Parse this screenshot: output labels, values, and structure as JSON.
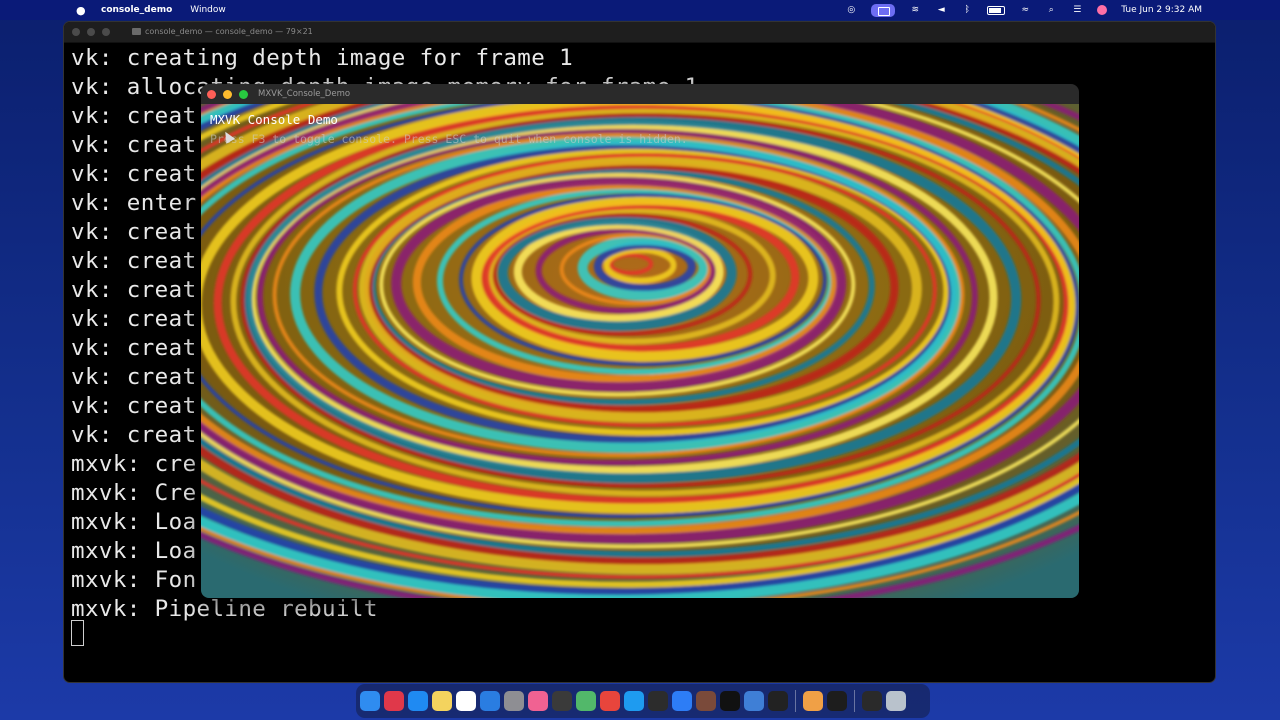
{
  "menubar": {
    "apple": "",
    "app_name": "console_demo",
    "menu_window": "Window",
    "datetime": "Tue Jun 2  9:32 AM",
    "icons": [
      "screen-record-icon",
      "display-icon",
      "stage-manager-icon",
      "volume-icon",
      "bluetooth-icon",
      "battery-icon",
      "wifi-icon",
      "spotlight-icon",
      "control-center-icon",
      "siri-icon"
    ]
  },
  "terminal": {
    "title": "console_demo — console_demo — 79×21",
    "lines": [
      "vk: creating depth image for frame 1",
      "vk: allocating depth image memory for frame 1",
      "vk: creat",
      "vk: creat",
      "vk: creat",
      "vk: enter",
      "vk: creat",
      "vk: creat",
      "vk: creat",
      "vk: creat",
      "vk: creat",
      "vk: creat",
      "vk: creat",
      "vk: creat",
      "mxvk: cre",
      "mxvk: Cre",
      "mxvk: Loa",
      "mxvk: Loa",
      "mxvk: Fon",
      "mxvk: Pipeline rebuilt"
    ]
  },
  "demo": {
    "window_title": "MXVK_Console_Demo",
    "overlay_title": "MXVK Console Demo",
    "overlay_hint": "Press F3 to toggle console. Press ESC to quit when console is hidden."
  },
  "dock": {
    "apps": [
      {
        "name": "finder",
        "color": "#2f8cf0"
      },
      {
        "name": "launchpad",
        "color": "#e0384a"
      },
      {
        "name": "app-store",
        "color": "#1f8af2"
      },
      {
        "name": "notes",
        "color": "#f4d35e"
      },
      {
        "name": "reminders",
        "color": "#ffffff"
      },
      {
        "name": "windows-app",
        "color": "#2a7de1"
      },
      {
        "name": "system-settings",
        "color": "#8e8e93"
      },
      {
        "name": "photos",
        "color": "#f06292"
      },
      {
        "name": "activity-monitor",
        "color": "#3a3a3a"
      },
      {
        "name": "maps",
        "color": "#52b86a"
      },
      {
        "name": "chrome",
        "color": "#e8453c"
      },
      {
        "name": "safari",
        "color": "#1e9bf0"
      },
      {
        "name": "final-cut",
        "color": "#2c2c2c"
      },
      {
        "name": "xcode",
        "color": "#2d7df6"
      },
      {
        "name": "steam",
        "color": "#7a4a3a"
      },
      {
        "name": "x-app",
        "color": "#111111"
      },
      {
        "name": "ssd-utility",
        "color": "#3f7fd6"
      },
      {
        "name": "terminal",
        "color": "#222222"
      },
      {
        "name": "preview",
        "color": "#f0a046"
      },
      {
        "name": "console",
        "color": "#1d1d1d"
      },
      {
        "name": "downloads",
        "color": "#2a2a2a"
      },
      {
        "name": "trash",
        "color": "#b9c2cc"
      }
    ]
  }
}
